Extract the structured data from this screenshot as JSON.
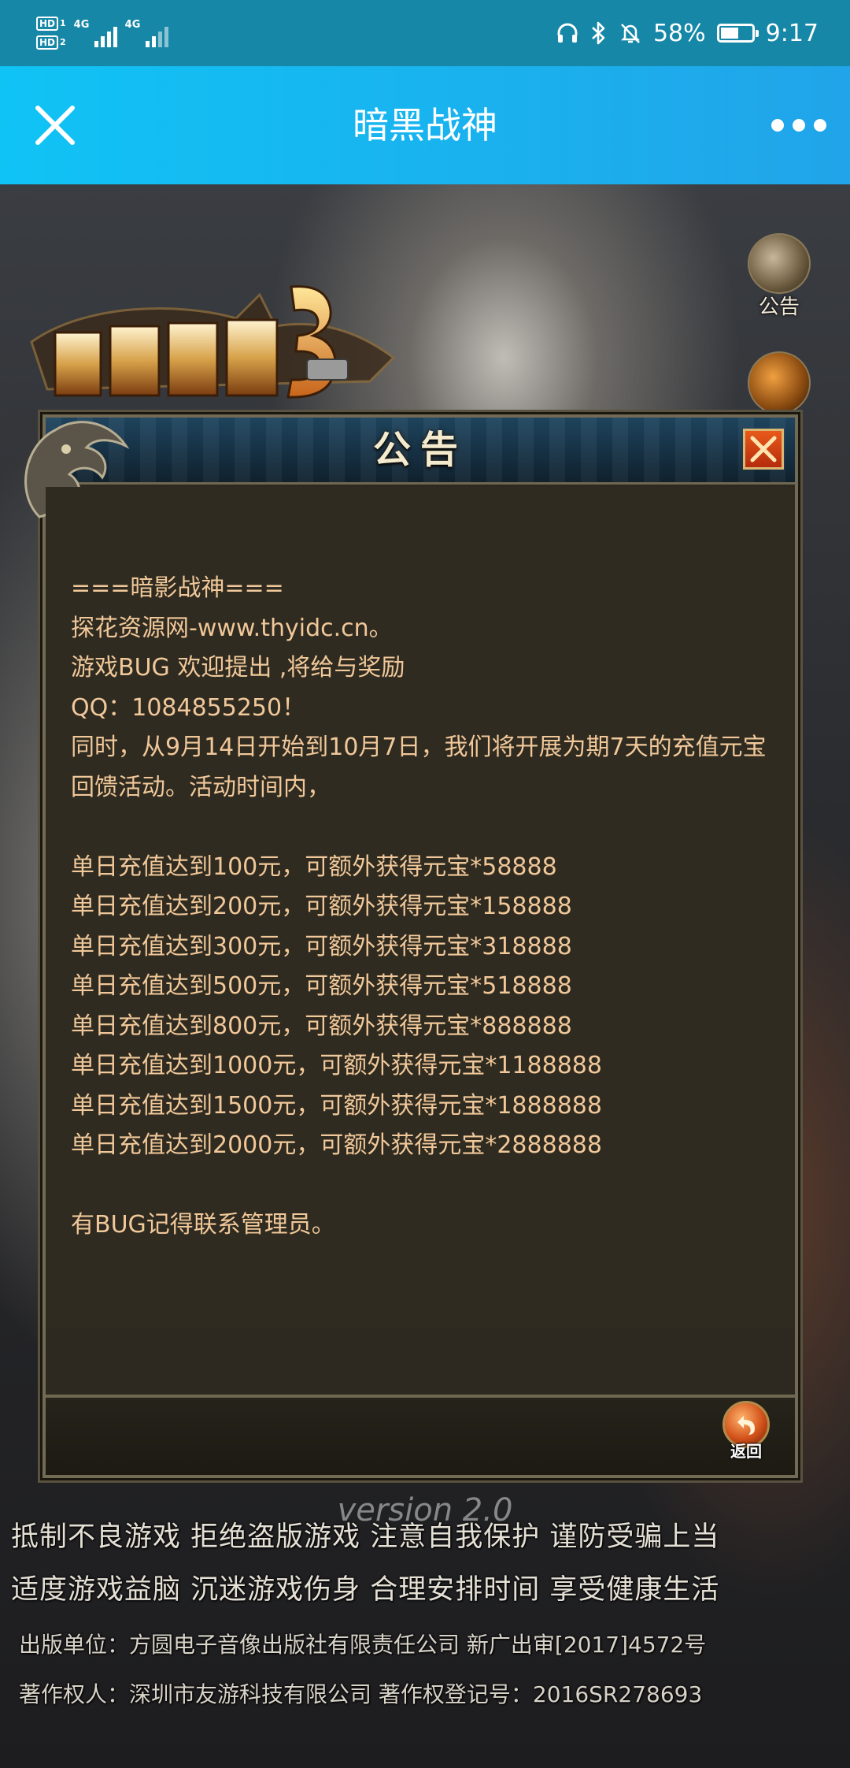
{
  "status_bar": {
    "hd1": "HD",
    "hd1_sub": "1",
    "hd2": "HD",
    "hd2_sub": "2",
    "net1": "4G",
    "net2": "4G",
    "battery_percent": "58%",
    "battery_level": 0.58,
    "time": "9:17"
  },
  "app_bar": {
    "title": "暗黑战神"
  },
  "game": {
    "side_icon_notice": "公告"
  },
  "dialog": {
    "title": "公告",
    "lines": [
      "===暗影战神===",
      "探花资源网-www.thyidc.cn。",
      "游戏BUG 欢迎提出 ,将给与奖励",
      "QQ：1084855250！",
      "同时，从9月14日开始到10月7日，我们将开展为期7天的充值元宝回馈活动。活动时间内，",
      "",
      "单日充值达到100元，可额外获得元宝*58888",
      "单日充值达到200元，可额外获得元宝*158888",
      "单日充值达到300元，可额外获得元宝*318888",
      "单日充值达到500元，可额外获得元宝*518888",
      "单日充值达到800元，可额外获得元宝*888888",
      "单日充值达到1000元，可额外获得元宝*1188888",
      "单日充值达到1500元，可额外获得元宝*1888888",
      "单日充值达到2000元，可额外获得元宝*2888888",
      "",
      "有BUG记得联系管理员。"
    ],
    "back_label": "返回"
  },
  "footer": {
    "version": "version 2.0",
    "slogan_line1": "抵制不良游戏  拒绝盗版游戏  注意自我保护  谨防受骗上当",
    "slogan_line2": "适度游戏益脑  沉迷游戏伤身  合理安排时间  享受健康生活",
    "publisher": "出版单位：方圆电子音像出版社有限责任公司  新广出审[2017]4572号",
    "copyright": "著作权人：深圳市友游科技有限公司      著作权登记号：2016SR278693"
  },
  "colors": {
    "status_bar": "#1687a7",
    "app_bar_start": "#10c3f5",
    "app_bar_end": "#21a4e9",
    "notice_text": "#f1c89a",
    "dialog_bg": "#2f2b20"
  }
}
